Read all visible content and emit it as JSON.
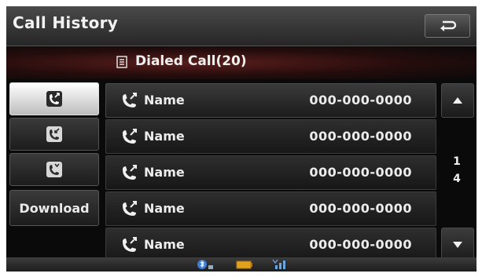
{
  "header": {
    "title": "Call History",
    "back_icon": "return-arrow-icon"
  },
  "list_header": {
    "icon": "list-icon",
    "label": "Dialed Call(20)"
  },
  "filters": [
    {
      "icon": "dialed-call-icon",
      "selected": true
    },
    {
      "icon": "received-call-icon",
      "selected": false
    },
    {
      "icon": "missed-call-icon",
      "selected": false
    },
    {
      "label": "Download"
    }
  ],
  "calls": [
    {
      "icon": "dialed-call-icon",
      "name": "Name",
      "number": "000-000-0000"
    },
    {
      "icon": "dialed-call-icon",
      "name": "Name",
      "number": "000-000-0000"
    },
    {
      "icon": "dialed-call-icon",
      "name": "Name",
      "number": "000-000-0000"
    },
    {
      "icon": "dialed-call-icon",
      "name": "Name",
      "number": "000-000-0000"
    },
    {
      "icon": "dialed-call-icon",
      "name": "Name",
      "number": "000-000-0000"
    }
  ],
  "pagination": {
    "current": "1",
    "total": "4"
  },
  "status_icons": [
    "bluetooth-phone-icon",
    "battery-icon",
    "signal-strength-icon"
  ],
  "colors": {
    "background": "#0a0a0a",
    "header_glow": "#5a1e1c",
    "text": "#ececec"
  }
}
